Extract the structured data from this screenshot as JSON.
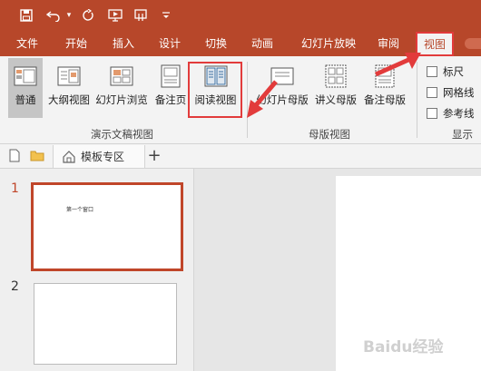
{
  "quick_access": [
    {
      "name": "save-icon"
    },
    {
      "name": "undo-icon"
    },
    {
      "name": "undo-dropdown-icon"
    },
    {
      "name": "redo-icon"
    },
    {
      "name": "present-from-start-icon"
    },
    {
      "name": "touch-mode-icon"
    },
    {
      "name": "customize-toolbar-icon"
    }
  ],
  "menu_tabs": [
    "文件",
    "开始",
    "插入",
    "设计",
    "切换",
    "动画",
    "幻灯片放映",
    "审阅",
    "视图"
  ],
  "active_tab": "视图",
  "ribbon": {
    "buttons": [
      "普通",
      "大纲视图",
      "幻灯片浏览",
      "备注页",
      "阅读视图",
      "幻灯片母版",
      "讲义母版",
      "备注母版"
    ],
    "groups": [
      "演示文稿视图",
      "母版视图",
      "显示"
    ],
    "checkboxes": [
      "标尺",
      "网格线",
      "参考线"
    ]
  },
  "doc_tab": {
    "label": "模板专区",
    "add": "+"
  },
  "slides": [
    {
      "number": "1",
      "text": "第一个窗口"
    },
    {
      "number": "2",
      "text": ""
    }
  ],
  "watermark": "Baidu经验",
  "colors": {
    "accent": "#b7472a",
    "highlight": "#e23b3b",
    "selected_slide_border": "#c0462a"
  }
}
